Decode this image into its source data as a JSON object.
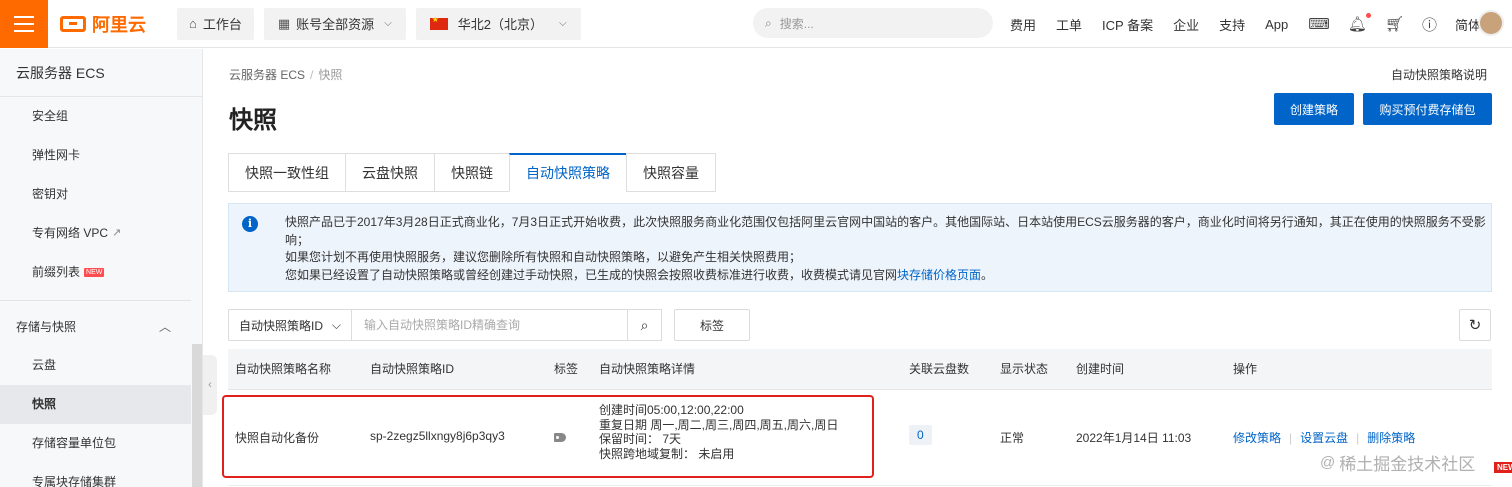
{
  "topbar": {
    "logo_text": "阿里云",
    "workbench": "工作台",
    "resource_scope": "账号全部资源",
    "region": "华北2（北京）",
    "search_placeholder": "搜索...",
    "links": [
      "费用",
      "工单",
      "ICP 备案",
      "企业",
      "支持",
      "App"
    ],
    "language": "简体"
  },
  "sidebar": {
    "title": "云服务器 ECS",
    "items_top": [
      {
        "label": "安全组"
      },
      {
        "label": "弹性网卡"
      },
      {
        "label": "密钥对"
      },
      {
        "label": "专有网络 VPC"
      },
      {
        "label": "前缀列表",
        "badge": "NEW"
      }
    ],
    "group_label": "存储与快照",
    "group_items": [
      {
        "label": "云盘"
      },
      {
        "label": "快照",
        "active": true
      },
      {
        "label": "存储容量单位包"
      },
      {
        "label": "专属块存储集群"
      }
    ]
  },
  "breadcrumb": {
    "root": "云服务器 ECS",
    "sep": "/",
    "current": "快照"
  },
  "help_link": "自动快照策略说明",
  "page_title": "快照",
  "buttons": {
    "create_policy": "创建策略",
    "buy_storage": "购买预付费存储包"
  },
  "tabs": [
    {
      "label": "快照一致性组"
    },
    {
      "label": "云盘快照"
    },
    {
      "label": "快照链"
    },
    {
      "label": "自动快照策略",
      "active": true
    },
    {
      "label": "快照容量"
    }
  ],
  "notice": {
    "line1": "快照产品已于2017年3月28日正式商业化，7月3日正式开始收费，此次快照服务商业化范围仅包括阿里云官网中国站的客户。其他国际站、日本站使用ECS云服务器的客户，商业化时间将另行通知，其正在使用的快照服务不受影",
    "line1b": "响；",
    "line2": "如果您计划不再使用快照服务，建议您删除所有快照和自动快照策略，以避免产生相关快照费用；",
    "line3": "您如果已经设置了自动快照策略或曾经创建过手动快照，已生成的快照会按照收费标准进行收费，收费模式请见官网",
    "line3_link": "块存储价格页面",
    "line3_end": "。"
  },
  "filter": {
    "field": "自动快照策略ID",
    "placeholder": "输入自动快照策略ID精确查询",
    "tag_button": "标签"
  },
  "table": {
    "headers": [
      "自动快照策略名称",
      "自动快照策略ID",
      "标签",
      "自动快照策略详情",
      "关联云盘数",
      "显示状态",
      "创建时间",
      "操作"
    ],
    "rows": [
      {
        "name": "快照自动化备份",
        "id": "sp-2zegz5llxngy8j6p3qy3",
        "detail": [
          "创建时间05:00,12:00,22:00",
          "重复日期 周一,周二,周三,周四,周五,周六,周日",
          "保留时间：  7天",
          "快照跨地域复制：  未启用"
        ],
        "disk_count": "0",
        "status": "正常",
        "created": "2022年1月14日 11:03",
        "actions": [
          "修改策略",
          "设置云盘",
          "删除策略"
        ]
      }
    ]
  },
  "watermark": "稀土掘金技术社区",
  "corner_badge": "NEW",
  "colors": {
    "brand": "#ff6a00",
    "primary": "#0064c8",
    "highlight": "#e0201b"
  }
}
